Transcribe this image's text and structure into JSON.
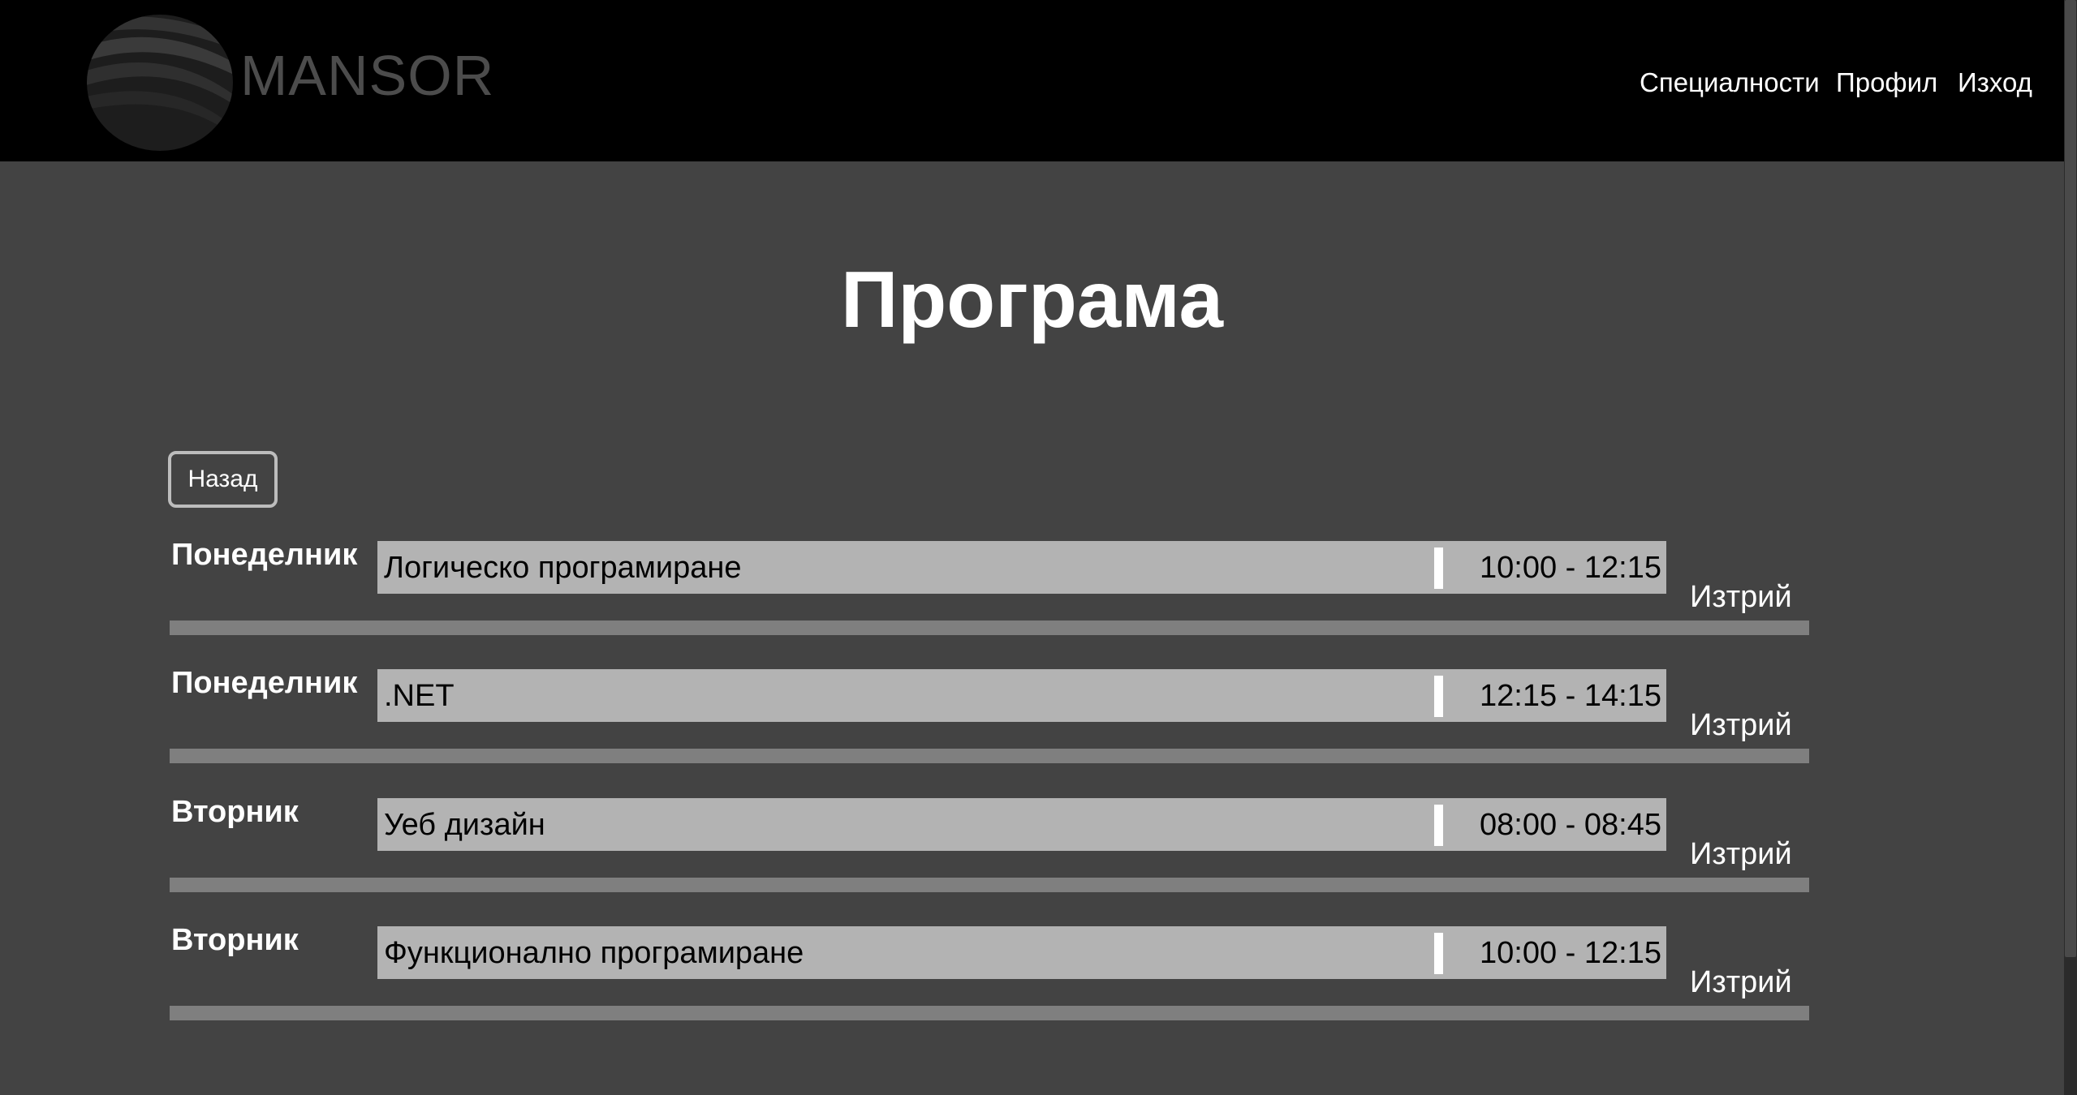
{
  "header": {
    "logo_text": "MANSOR",
    "nav": {
      "specialties": "Специалности",
      "profile": "Профил",
      "logout": "Изход"
    }
  },
  "main": {
    "title": "Програма",
    "back_label": "Назад",
    "delete_label": "Изтрий",
    "schedule": [
      {
        "day": "Понеделник",
        "subject": "Логическо програмиране",
        "time": "10:00 - 12:15"
      },
      {
        "day": "Понеделник",
        "subject": ".NET",
        "time": "12:15 - 14:15"
      },
      {
        "day": "Вторник",
        "subject": "Уеб дизайн",
        "time": "08:00 - 08:45"
      },
      {
        "day": "Вторник",
        "subject": "Функционално програмиране",
        "time": "10:00 - 12:15"
      }
    ]
  }
}
